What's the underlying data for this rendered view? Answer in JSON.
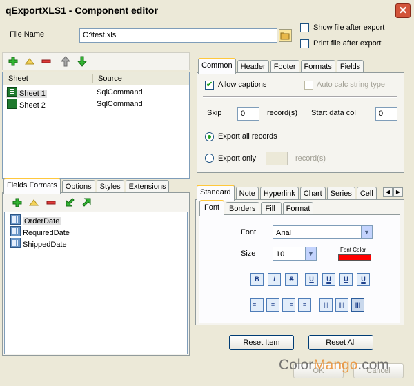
{
  "window": {
    "title": "qExportXLS1 - Component editor",
    "close_glyph": "✕"
  },
  "file": {
    "label": "File Name",
    "value": "C:\\test.xls"
  },
  "options": {
    "show_after": "Show file after export",
    "print_after": "Print file after export"
  },
  "sheets": {
    "columns": [
      "Sheet",
      "Source"
    ],
    "rows": [
      {
        "sheet": "Sheet 1",
        "source": "SqlCommand"
      },
      {
        "sheet": "Sheet 2",
        "source": "SqlCommand"
      }
    ]
  },
  "toolbar_icons": [
    "add-icon",
    "edit-icon",
    "remove-icon",
    "move-up-icon",
    "move-down-icon"
  ],
  "lower_left": {
    "tabs": [
      "Fields Formats",
      "Options",
      "Styles",
      "Extensions"
    ],
    "fields": [
      "OrderDate",
      "RequiredDate",
      "ShippedDate"
    ]
  },
  "common": {
    "tabs": [
      "Common",
      "Header",
      "Footer",
      "Formats",
      "Fields"
    ],
    "allow_captions": "Allow captions",
    "auto_calc": "Auto calc string type",
    "skip_label": "Skip",
    "skip_value": "0",
    "records_label": "record(s)",
    "start_col_label": "Start data col",
    "start_col_value": "0",
    "export_all": "Export all records",
    "export_only": "Export only",
    "records_label2": "record(s)"
  },
  "standard": {
    "tabs": [
      "Standard",
      "Note",
      "Hyperlink",
      "Chart",
      "Series",
      "Cell"
    ],
    "scroll_left": "◀",
    "scroll_right": "▶",
    "subtabs": [
      "Font",
      "Borders",
      "Fill",
      "Format"
    ],
    "font_label": "Font",
    "font_value": "Arial",
    "size_label": "Size",
    "size_value": "10",
    "font_color_label": "Font Color",
    "font_color": "#ff0000",
    "style_buttons": [
      "B",
      "I",
      "S",
      "U",
      "U",
      "U",
      "U"
    ],
    "align_buttons": [
      "≡",
      "≡",
      "≡",
      "≡",
      "|||",
      "|||",
      "|||"
    ]
  },
  "buttons": {
    "reset_item": "Reset Item",
    "reset_all": "Reset All",
    "ok": "OK",
    "cancel": "Cancel"
  },
  "watermark": {
    "text_a": "Color",
    "text_b": "Mango",
    "text_c": ".com"
  }
}
